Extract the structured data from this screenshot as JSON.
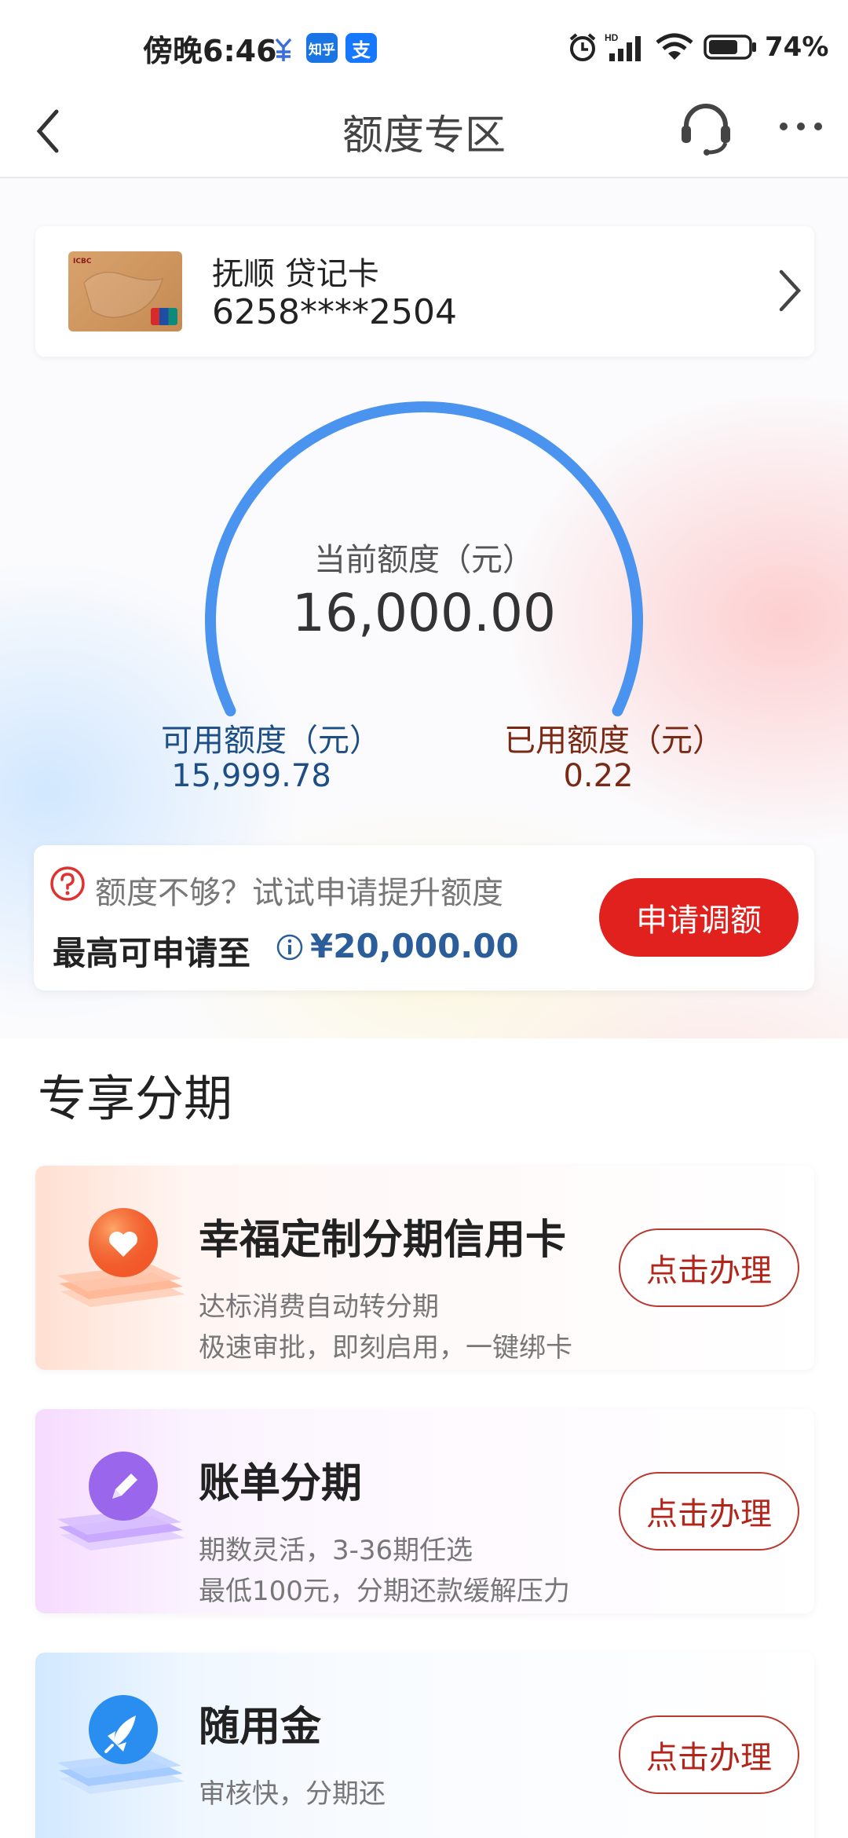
{
  "status_bar": {
    "time": "傍晚6:46",
    "app_icons": [
      "知乎",
      "支"
    ],
    "battery": "74%"
  },
  "nav": {
    "title": "额度专区"
  },
  "card": {
    "name": "抚顺 贷记卡",
    "number": "6258****2504"
  },
  "gauge": {
    "label": "当前额度（元）",
    "value": "16,000.00",
    "used_fraction": 1.37e-05,
    "arc_color": "#4a94ef"
  },
  "available": {
    "label": "可用额度（元）",
    "value": "15,999.78"
  },
  "used": {
    "label": "已用额度（元）",
    "value": "0.22"
  },
  "limit_increase": {
    "question": "额度不够？试试申请提升额度",
    "max_label": "最高可申请至",
    "max_value": "¥20,000.00",
    "button": "申请调额"
  },
  "installments": {
    "section_title": "专享分期",
    "items": [
      {
        "title": "幸福定制分期信用卡",
        "desc1": "达标消费自动转分期",
        "desc2": "极速审批，即刻启用，一键绑卡",
        "button": "点击办理",
        "icon": "heart-icon"
      },
      {
        "title": "账单分期",
        "desc1": "期数灵活，3-36期任选",
        "desc2": "最低100元，分期还款缓解压力",
        "button": "点击办理",
        "icon": "pencil-icon"
      },
      {
        "title": "随用金",
        "desc1": "审核快，分期还",
        "desc2": "",
        "button": "点击办理",
        "icon": "rocket-icon"
      }
    ]
  },
  "colors": {
    "primary_red": "#e0211e",
    "blue_text": "#1d4f86",
    "brown_text": "#7a2a14"
  }
}
